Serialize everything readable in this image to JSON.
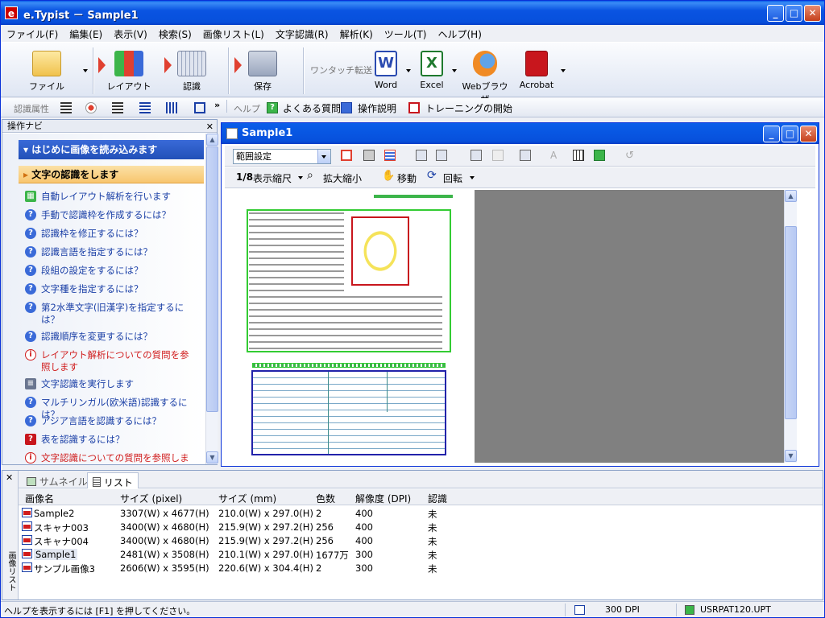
{
  "app": {
    "title": "e.Typist － Sample1",
    "icon_letter": "e"
  },
  "menu": [
    "ファイル(F)",
    "編集(E)",
    "表示(V)",
    "検索(S)",
    "画像リスト(L)",
    "文字認識(R)",
    "解析(K)",
    "ツール(T)",
    "ヘルプ(H)"
  ],
  "toolbar": {
    "file": "ファイル",
    "layout": "レイアウト",
    "recognize": "認識",
    "save": "保存",
    "onetouch_label": "ワンタッチ転送",
    "word": "Word",
    "excel": "Excel",
    "web": "Webブラウザ",
    "acrobat": "Acrobat"
  },
  "toolbar2": {
    "attr_label": "認識属性",
    "help_label": "ヘルプ",
    "faq": "よくある質問",
    "manual": "操作説明",
    "training": "トレーニングの開始",
    "more": "»"
  },
  "nav": {
    "title": "操作ナビ",
    "section1": "はじめに画像を読み込みます",
    "section2": "文字の認識をします",
    "items": [
      {
        "text": "自動レイアウト解析を行います",
        "type": "layout"
      },
      {
        "text": "手動で認識枠を作成するには？",
        "type": "q"
      },
      {
        "text": "認識枠を修正するには？",
        "type": "q"
      },
      {
        "text": "認識言語を指定するには？",
        "type": "q"
      },
      {
        "text": "段組の設定をするには？",
        "type": "q"
      },
      {
        "text": "文字種を指定するには？",
        "type": "q"
      },
      {
        "text": "第2水準文字(旧漢字)を指定するには？",
        "type": "q"
      },
      {
        "text": "認識順序を変更するには？",
        "type": "q"
      },
      {
        "text": "レイアウト解析についての質問を参照します",
        "type": "info"
      },
      {
        "text": "文字認識を実行します",
        "type": "run"
      },
      {
        "text": "マルチリンガル(欧米語)認識するには？",
        "type": "q"
      },
      {
        "text": "アジア言語を認識するには？",
        "type": "q"
      },
      {
        "text": "表を認識するには？",
        "type": "q2"
      },
      {
        "text": "文字認識についての質問を参照します",
        "type": "info"
      }
    ]
  },
  "doc": {
    "title": "Sample1",
    "range_select": "範囲設定",
    "zoom_label": "表示縮尺",
    "zoom_value": "1/8",
    "zoom_tool": "拡大縮小",
    "move": "移動",
    "rotate": "回転"
  },
  "list": {
    "tabs": [
      "サムネイル",
      "リスト"
    ],
    "side_label": "画像リスト",
    "columns": [
      "画像名",
      "サイズ (pixel)",
      "サイズ (mm)",
      "色数",
      "解像度 (DPI)",
      "認識"
    ],
    "rows": [
      [
        "Sample2",
        "3307(W) x 4677(H)",
        "210.0(W) x 297.0(H)",
        "2",
        "400",
        "未"
      ],
      [
        "スキャナ003",
        "3400(W) x 4680(H)",
        "215.9(W) x 297.2(H)",
        "256",
        "400",
        "未"
      ],
      [
        "スキャナ004",
        "3400(W) x 4680(H)",
        "215.9(W) x 297.2(H)",
        "256",
        "400",
        "未"
      ],
      [
        "Sample1",
        "2481(W) x 3508(H)",
        "210.1(W) x 297.0(H)",
        "1677万",
        "300",
        "未"
      ],
      [
        "サンプル画像3",
        "2606(W) x 3595(H)",
        "220.6(W) x 304.4(H)",
        "2",
        "300",
        "未"
      ]
    ]
  },
  "status": {
    "help": "ヘルプを表示するには [F1] を押してください。",
    "dpi": "300 DPI",
    "file": "USRPAT120.UPT"
  }
}
